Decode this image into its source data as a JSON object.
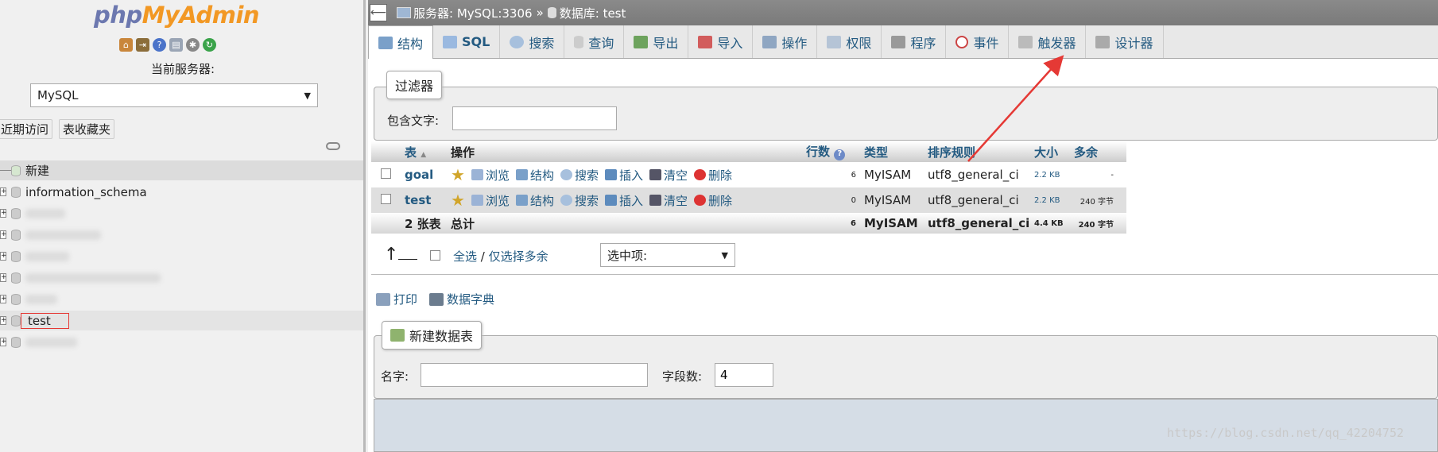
{
  "logo": {
    "part1": "php",
    "part2": "MyAdmin"
  },
  "left": {
    "server_label": "当前服务器:",
    "server_select": "MySQL",
    "recent_btn": "近期访问",
    "fav_btn": "表收藏夹",
    "tree": {
      "new": "新建",
      "items": [
        "information_schema",
        "test"
      ]
    }
  },
  "breadcrumb": {
    "server": "服务器: MySQL:3306",
    "sep": "»",
    "db": "数据库: test"
  },
  "tabs": [
    "结构",
    "SQL",
    "搜索",
    "查询",
    "导出",
    "导入",
    "操作",
    "权限",
    "程序",
    "事件",
    "触发器",
    "设计器"
  ],
  "filter": {
    "legend": "过滤器",
    "label": "包含文字:",
    "value": ""
  },
  "table": {
    "headers": {
      "table": "表",
      "ops": "操作",
      "rows": "行数",
      "type": "类型",
      "collation": "排序规则",
      "size": "大小",
      "overhead": "多余"
    },
    "actions": [
      "浏览",
      "结构",
      "搜索",
      "插入",
      "清空",
      "删除"
    ],
    "rows": [
      {
        "name": "goal",
        "rows": "6",
        "type": "MyISAM",
        "collation": "utf8_general_ci",
        "size": "2.2 KB",
        "overhead": "-"
      },
      {
        "name": "test",
        "rows": "0",
        "type": "MyISAM",
        "collation": "utf8_general_ci",
        "size": "2.2 KB",
        "overhead": "240 字节"
      }
    ],
    "total": {
      "count": "2 张表",
      "label": "总计",
      "rows": "6",
      "type": "MyISAM",
      "collation": "utf8_general_ci",
      "size": "4.4 KB",
      "overhead": "240 字节"
    }
  },
  "bulk": {
    "check_all": "全选",
    "sep": "/",
    "check_overhead": "仅选择多余",
    "with_selected": "选中项:"
  },
  "links": {
    "print": "打印",
    "dict": "数据字典"
  },
  "create": {
    "legend": "新建数据表",
    "name_label": "名字:",
    "name_value": "",
    "cols_label": "字段数:",
    "cols_value": "4"
  },
  "watermark": "https://blog.csdn.net/qq_42204752",
  "colors": {
    "link": "#235a81",
    "arrow": "#e53935",
    "highlight": "#e53935"
  }
}
